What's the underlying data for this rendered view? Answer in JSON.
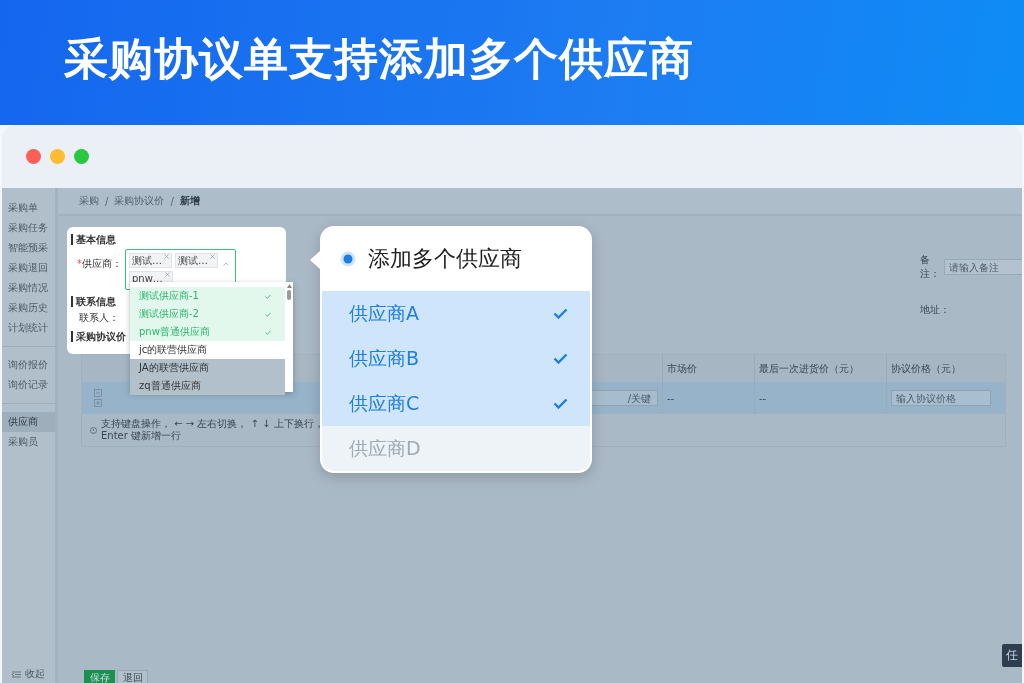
{
  "banner": {
    "title": "采购协议单支持添加多个供应商"
  },
  "sidebar": {
    "groups": [
      {
        "items": [
          {
            "label": "采购单",
            "selected": false
          },
          {
            "label": "采购任务",
            "selected": false
          },
          {
            "label": "智能预采",
            "selected": false
          },
          {
            "label": "采购退回",
            "selected": false
          },
          {
            "label": "采购情况",
            "selected": false
          },
          {
            "label": "采购历史",
            "selected": false
          },
          {
            "label": "计划统计",
            "selected": false
          }
        ]
      },
      {
        "items": [
          {
            "label": "询价报价",
            "selected": false
          },
          {
            "label": "询价记录",
            "selected": false
          }
        ]
      },
      {
        "items": [
          {
            "label": "供应商",
            "selected": true
          },
          {
            "label": "采购员",
            "selected": false
          }
        ]
      }
    ],
    "collapse": "收起"
  },
  "breadcrumb": {
    "items": [
      "采购",
      "采购协议价",
      "新增"
    ],
    "separator": "/"
  },
  "form": {
    "basic_section": "基本信息",
    "supplier": {
      "label": "供应商：",
      "required": true,
      "required_mark": "*",
      "tags": [
        "测试…",
        "测试…",
        "pnw…"
      ]
    },
    "contact_section": "联系信息",
    "contact_label": "联系人：",
    "price_section": "采购协议价",
    "remark": {
      "label": "备注：",
      "placeholder": "请输入备注"
    },
    "address_label": "地址："
  },
  "supplier_dropdown": [
    {
      "label": "测试供应商-1",
      "selected": true
    },
    {
      "label": "测试供应商-2",
      "selected": true
    },
    {
      "label": "pnw普通供应商",
      "selected": true
    },
    {
      "label": "jc的联营供应商",
      "selected": false
    },
    {
      "label": "JA的联营供应商",
      "selected": false
    },
    {
      "label": "zq普通供应商",
      "selected": false
    }
  ],
  "table": {
    "columns": [
      "市场价",
      "最后一次进货价（元）",
      "协议价格（元）"
    ],
    "rows": [
      {
        "search_placeholder": "/关键",
        "market_price": "--",
        "last_price": "--",
        "price_placeholder": "输入协议价格"
      }
    ],
    "hint": "支持键盘操作， ← → 左右切换， ↑ ↓ 上下换行，Enter 键新增一行"
  },
  "footer": {
    "buttons": [
      {
        "label": "保存",
        "kind": "primary"
      },
      {
        "label": "退回",
        "kind": "default"
      }
    ]
  },
  "callout": {
    "title": "添加多个供应商",
    "options": [
      {
        "label": "供应商A",
        "selected": true
      },
      {
        "label": "供应商B",
        "selected": true
      },
      {
        "label": "供应商C",
        "selected": true
      },
      {
        "label": "供应商D",
        "selected": false
      }
    ]
  },
  "task_badge": "任"
}
